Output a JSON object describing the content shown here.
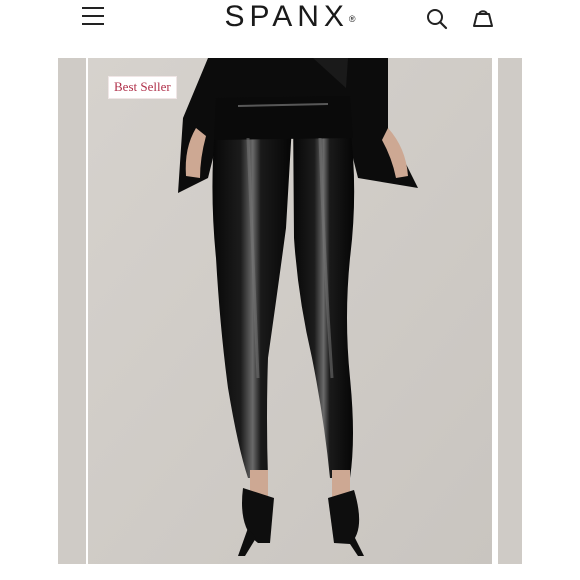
{
  "header": {
    "brand": "SPANX",
    "brand_mark": "®",
    "menu_icon": "hamburger-menu-icon",
    "search_icon": "search-icon",
    "cart_icon": "shopping-bag-icon"
  },
  "product": {
    "badge": "Best Seller"
  },
  "colors": {
    "background": "#ffffff",
    "photo_backdrop": "#cfcbc6",
    "badge_text": "#b0304a",
    "product": "#0b0b0b"
  }
}
